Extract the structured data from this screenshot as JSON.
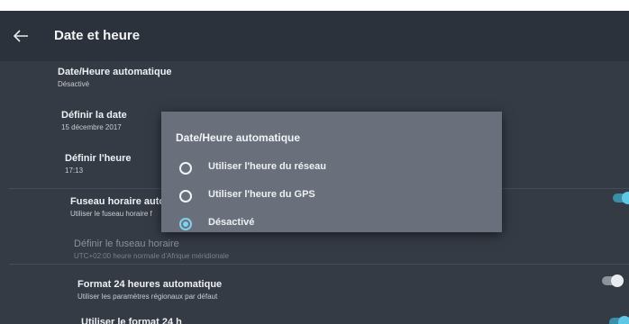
{
  "header": {
    "title": "Date et heure",
    "back_icon": "arrow-left-icon"
  },
  "settings": [
    {
      "label": "Date/Heure automatique",
      "summary": "Désactivé"
    },
    {
      "label": "Définir la date",
      "summary": "15 décembre 2017"
    },
    {
      "label": "Définir l'heure",
      "summary": "17:13"
    },
    {
      "label": "Fuseau horaire automa",
      "summary": "Utiliser le fuseau horaire f",
      "toggle": "on"
    },
    {
      "label": "Définir le fuseau horaire",
      "summary": "UTC+02:00 heure normale d'Afrique méridionale",
      "disabled": true
    },
    {
      "label": "Format 24 heures automatique",
      "summary": "Utiliser les paramètres régionaux par défaut",
      "toggle": "off"
    },
    {
      "label": "Utiliser le format 24 h",
      "toggle": "on"
    }
  ],
  "dialog": {
    "title": "Date/Heure automatique",
    "options": [
      {
        "label": "Utiliser l'heure du réseau",
        "selected": false
      },
      {
        "label": "Utiliser l'heure du GPS",
        "selected": false
      },
      {
        "label": "Désactivé",
        "selected": true
      }
    ]
  },
  "colors": {
    "background": "#353b45",
    "dialog": "#69707c",
    "accent": "#7fd1ee"
  }
}
